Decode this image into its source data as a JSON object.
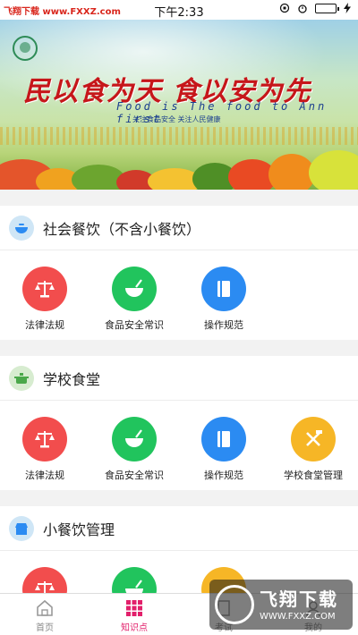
{
  "status_bar": {
    "left_text": "飞翔下载 www.FXXZ.com",
    "time": "下午2:33"
  },
  "banner": {
    "slogan": "民以食为天 食以安为先",
    "slogan_en": "Food is The food to Ann first",
    "slogan_sub": "关注食品安全 关注人民健康"
  },
  "sections": [
    {
      "title": "社会餐饮（不含小餐饮）",
      "icon": "bowl-icon",
      "items": [
        {
          "label": "法律法规",
          "icon": "scales-icon",
          "color": "#f24d4d"
        },
        {
          "label": "食品安全常识",
          "icon": "bowl-spoon-icon",
          "color": "#21c45d"
        },
        {
          "label": "操作规范",
          "icon": "book-icon",
          "color": "#2b8bf2"
        }
      ]
    },
    {
      "title": "学校食堂",
      "icon": "pot-icon",
      "items": [
        {
          "label": "法律法规",
          "icon": "scales-icon",
          "color": "#f24d4d"
        },
        {
          "label": "食品安全常识",
          "icon": "bowl-spoon-icon",
          "color": "#21c45d"
        },
        {
          "label": "操作规范",
          "icon": "book-icon",
          "color": "#2b8bf2"
        },
        {
          "label": "学校食堂管理",
          "icon": "tools-icon",
          "color": "#f6b626"
        }
      ]
    },
    {
      "title": "小餐饮管理",
      "icon": "shop-icon",
      "items": [
        {
          "label": "",
          "icon": "scales-icon",
          "color": "#f24d4d"
        },
        {
          "label": "",
          "icon": "bowl-spoon-icon",
          "color": "#21c45d"
        },
        {
          "label": "",
          "icon": "book-icon",
          "color": "#2b8bf2"
        },
        {
          "label": "",
          "icon": "tools-icon",
          "color": "#f6b626"
        }
      ]
    }
  ],
  "tabbar": {
    "tabs": [
      {
        "label": "首页",
        "icon": "home-icon",
        "active": false
      },
      {
        "label": "知识点",
        "icon": "grid-icon",
        "active": true
      },
      {
        "label": "考试",
        "icon": "exam-icon",
        "active": false
      },
      {
        "label": "我的",
        "icon": "user-icon",
        "active": false
      }
    ],
    "active_color": "#e2206b"
  },
  "watermark": {
    "title": "飞翔下载",
    "url": "WWW.FXXZ.COM"
  }
}
